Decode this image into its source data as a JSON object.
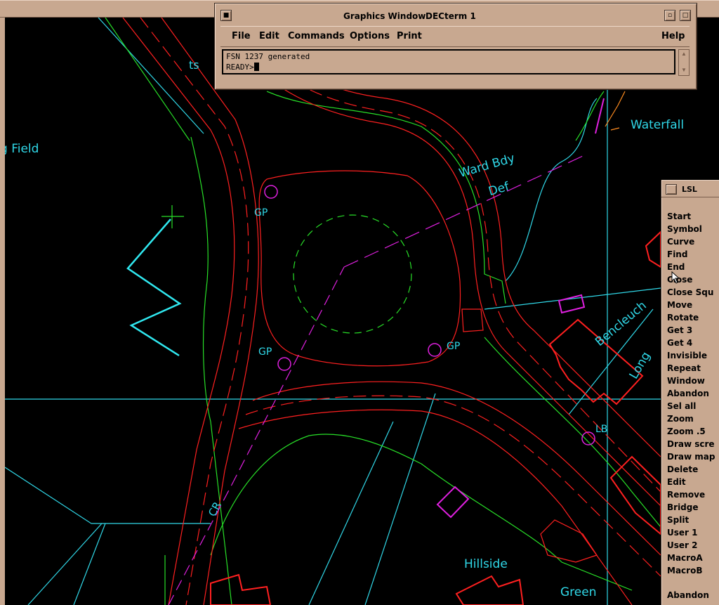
{
  "graphics_window": {
    "title": "Graphics Window"
  },
  "decterm": {
    "title": "DECterm 1",
    "menu": [
      "File",
      "Edit",
      "Commands",
      "Options",
      "Print"
    ],
    "help": "Help",
    "output_line": "FSN 1237 generated",
    "prompt": "READY>"
  },
  "map_labels": {
    "field": "g Field",
    "waterfall": "Waterfall",
    "ward": "Ward Bdy",
    "def": "Def",
    "gp1": "GP",
    "gp2": "GP",
    "gp3": "GP",
    "lb": "LB",
    "cr": "CR",
    "hillside": "Hillside",
    "green": "Green",
    "bencleuch": "Bencleuch",
    "long": "Long",
    "ts": "ts"
  },
  "lsl": {
    "title": "LSL",
    "items": [
      "Start",
      "Symbol",
      "Curve",
      "Find",
      "End",
      "Close",
      "Close Squ",
      "Move",
      "Rotate",
      "Get 3",
      "Get 4",
      "Invisible",
      "Repeat",
      "Window",
      "Abandon",
      "Sel all",
      "Zoom",
      "Zoom .5",
      "Draw scre",
      "Draw map",
      "Delete",
      "Edit",
      "Remove",
      "Bridge",
      "Split",
      "User 1",
      "User 2",
      "MacroA",
      "MacroB"
    ],
    "last_item": "Abandon"
  },
  "colors": {
    "red": "#ff2020",
    "green": "#28e028",
    "cyan": "#30d8e8",
    "magenta": "#e020e0",
    "frame": "#c8a890"
  }
}
